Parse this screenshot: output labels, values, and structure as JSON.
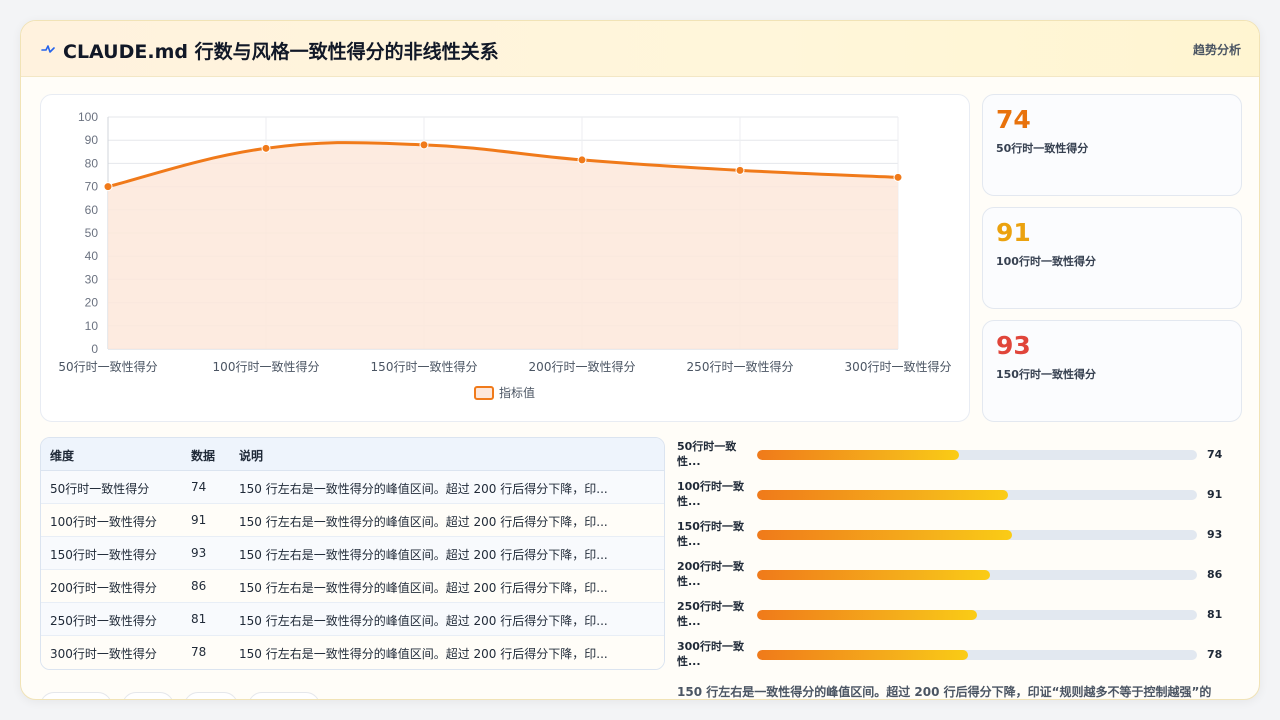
{
  "header": {
    "icon": "pulse-icon",
    "title": "CLAUDE.md 行数与风格一致性得分的非线性关系",
    "right_label": "趋势分析"
  },
  "colors": {
    "accent": "#f07a1a",
    "fill": "#fde7db",
    "stat1": "#e8720c",
    "stat2": "#eba20f",
    "stat3": "#e0453a"
  },
  "chart_data": {
    "type": "area",
    "categories": [
      "50行时一致性得分",
      "100行时一致性得分",
      "150行时一致性得分",
      "200行时一致性得分",
      "250行时一致性得分",
      "300行时一致性得分"
    ],
    "series": [
      {
        "name": "指标值",
        "values": [
          70,
          86.5,
          88,
          81.5,
          77,
          74
        ]
      }
    ],
    "ylim": [
      0,
      100
    ],
    "yticks": [
      0,
      10,
      20,
      30,
      40,
      50,
      60,
      70,
      80,
      90,
      100
    ],
    "grid": true,
    "legend": "bottom"
  },
  "stats": [
    {
      "value": "74",
      "label": "50行时一致性得分"
    },
    {
      "value": "91",
      "label": "100行时一致性得分"
    },
    {
      "value": "93",
      "label": "150行时一致性得分"
    }
  ],
  "table": {
    "headers": [
      "维度",
      "数据",
      "说明"
    ],
    "rows": [
      [
        "50行时一致性得分",
        "74",
        "150 行左右是一致性得分的峰值区间。超过 200 行后得分下降，印..."
      ],
      [
        "100行时一致性得分",
        "91",
        "150 行左右是一致性得分的峰值区间。超过 200 行后得分下降，印..."
      ],
      [
        "150行时一致性得分",
        "93",
        "150 行左右是一致性得分的峰值区间。超过 200 行后得分下降，印..."
      ],
      [
        "200行时一致性得分",
        "86",
        "150 行左右是一致性得分的峰值区间。超过 200 行后得分下降，印..."
      ],
      [
        "250行时一致性得分",
        "81",
        "150 行左右是一致性得分的峰值区间。超过 200 行后得分下降，印..."
      ],
      [
        "300行时一致性得分",
        "78",
        "150 行左右是一致性得分的峰值区间。超过 200 行后得分下降，印..."
      ]
    ]
  },
  "bars": [
    {
      "label": "50行时一致性...",
      "value": 74,
      "value_label": "74",
      "fill_pct": 46
    },
    {
      "label": "100行时一致性...",
      "value": 91,
      "value_label": "91",
      "fill_pct": 57
    },
    {
      "label": "150行时一致性...",
      "value": 93,
      "value_label": "93",
      "fill_pct": 58
    },
    {
      "label": "200行时一致性...",
      "value": 86,
      "value_label": "86",
      "fill_pct": 53
    },
    {
      "label": "250行时一致性...",
      "value": 81,
      "value_label": "81",
      "fill_pct": 50
    },
    {
      "label": "300行时一致性...",
      "value": 78,
      "value_label": "78",
      "fill_pct": 48
    }
  ],
  "note": "150 行左右是一致性得分的峰值区间。超过 200 行后得分下降，印证“规则越多不等于控制越强”的"
}
